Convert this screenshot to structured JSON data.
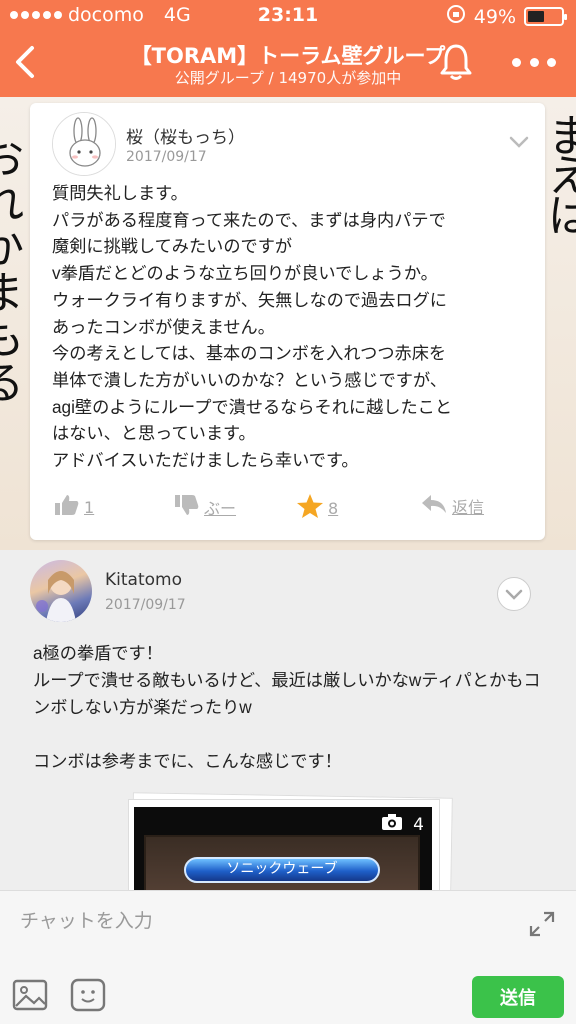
{
  "status_bar": {
    "carrier": "docomo",
    "network": "4G",
    "time": "23:11",
    "battery": "49%",
    "battery_level": 0.49
  },
  "header": {
    "title": "【TORAM】トーラム壁グループ",
    "subtitle": "公開グループ / 14970人が参加中",
    "accent": "#f7784e"
  },
  "post": {
    "author": "桜（桜もっち）",
    "date": "2017/09/17",
    "body": "質問失礼します。\nパラがある程度育って来たので、まずは身内パテで\n魔剣に挑戦してみたいのですが\nv拳盾だとどのような立ち回りが良いでしょうか。\nウォークライ有りますが、矢無しなので過去ログに\nあったコンボが使えません。\n今の考えとしては、基本のコンボを入れつつ赤床を\n単体で潰した方がいいのかな？という感じですが、\nagi壁のようにループで潰せるならそれに越したこと\nはない、と思っています。\nアドバイスいただけましたら幸いです。",
    "like_count": "1",
    "boo_label": "ぶー",
    "star_count": "8",
    "reply_label": "返信"
  },
  "background_chars": [
    "ま",
    "え",
    "は",
    "お",
    "れ",
    "か",
    "ま",
    "も",
    "る"
  ],
  "reply": {
    "author": "Kitatomo",
    "date": "2017/09/17",
    "body": "a極の拳盾です！\nループで潰せる敵もいるけど、最近は厳しいかなwティパとかもコンボしない方が楽だったりw\n\nコンボは参考までに、こんな感じです！",
    "photo_count": "4",
    "photo_button_label": "ソニックウェーブ"
  },
  "input": {
    "placeholder": "チャットを入力",
    "send_label": "送信",
    "send_color": "#3bc24a"
  }
}
